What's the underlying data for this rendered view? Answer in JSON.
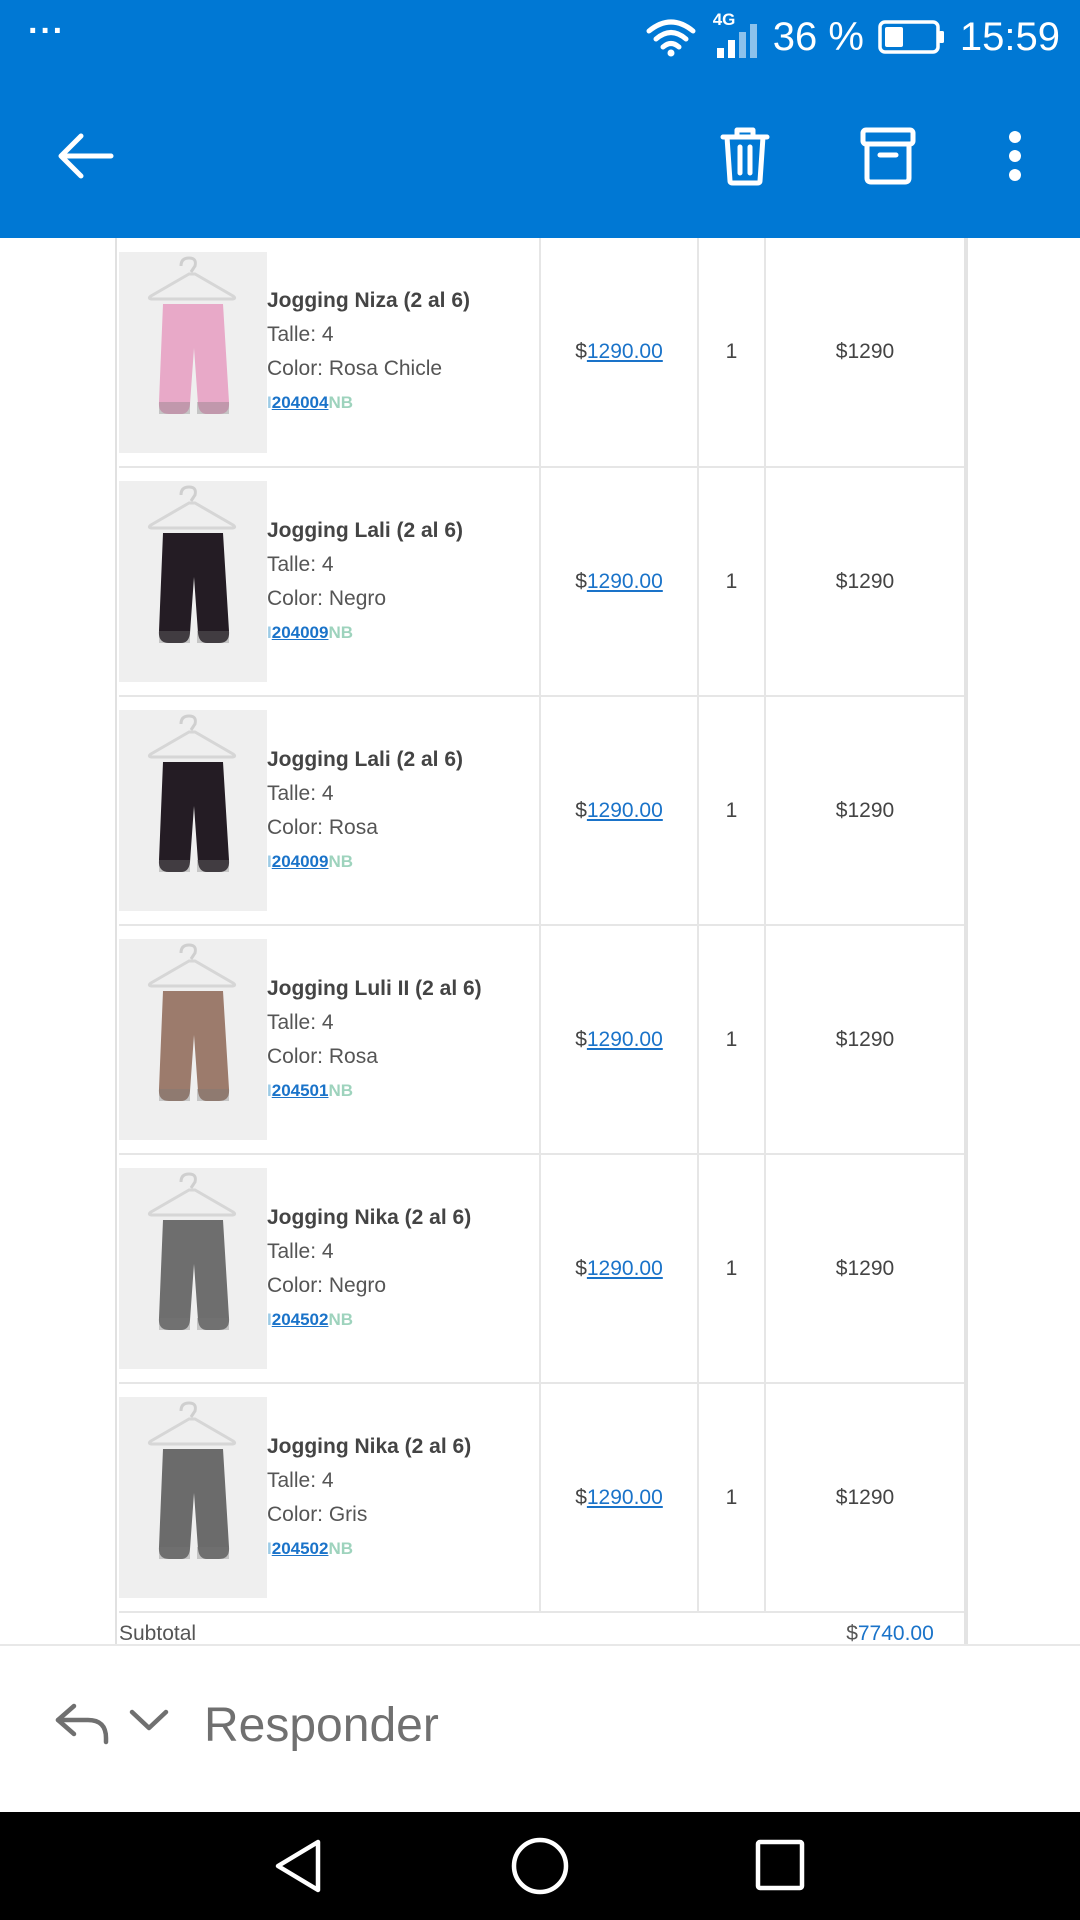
{
  "status_bar": {
    "menu_dots": "···",
    "network": "4G",
    "battery_percent": "36 %",
    "time": "15:59",
    "battery_level": 0.36
  },
  "app_bar": {
    "icons": [
      "back-arrow-icon",
      "trash-icon",
      "archive-icon",
      "more-vert-icon"
    ]
  },
  "items": [
    {
      "name": "Jogging Niza (2 al 6)",
      "size": "Talle: 4",
      "color": "Color: Rosa Chicle",
      "sku_prefix": "I",
      "sku_code": "204004",
      "sku_suffix": "NB",
      "currency": "$",
      "price": "1290.00",
      "qty": "1",
      "total": "$1290",
      "pants_color": "#e8a9c8"
    },
    {
      "name": "Jogging Lali (2 al 6)",
      "size": "Talle: 4",
      "color": "Color: Negro",
      "sku_prefix": "I",
      "sku_code": "204009",
      "sku_suffix": "NB",
      "currency": "$",
      "price": "1290.00",
      "qty": "1",
      "total": "$1290",
      "pants_color": "#241c24"
    },
    {
      "name": "Jogging Lali (2 al 6)",
      "size": "Talle: 4",
      "color": "Color: Rosa",
      "sku_prefix": "I",
      "sku_code": "204009",
      "sku_suffix": "NB",
      "currency": "$",
      "price": "1290.00",
      "qty": "1",
      "total": "$1290",
      "pants_color": "#241c24"
    },
    {
      "name": "Jogging Luli II (2 al 6)",
      "size": "Talle: 4",
      "color": "Color: Rosa",
      "sku_prefix": "I",
      "sku_code": "204501",
      "sku_suffix": "NB",
      "currency": "$",
      "price": "1290.00",
      "qty": "1",
      "total": "$1290",
      "pants_color": "#9c7b6c"
    },
    {
      "name": "Jogging Nika (2 al 6)",
      "size": "Talle: 4",
      "color": "Color: Negro",
      "sku_prefix": "I",
      "sku_code": "204502",
      "sku_suffix": "NB",
      "currency": "$",
      "price": "1290.00",
      "qty": "1",
      "total": "$1290",
      "pants_color": "#6e6e6e"
    },
    {
      "name": "Jogging Nika (2 al 6)",
      "size": "Talle: 4",
      "color": "Color: Gris",
      "sku_prefix": "I",
      "sku_code": "204502",
      "sku_suffix": "NB",
      "currency": "$",
      "price": "1290.00",
      "qty": "1",
      "total": "$1290",
      "pants_color": "#6b6b6b"
    }
  ],
  "subtotal": {
    "label": "Subtotal",
    "currency": "$",
    "value": "7740.00"
  },
  "reply_bar": {
    "label": "Responder"
  },
  "nav_bar": {
    "icons": [
      "nav-back-icon",
      "nav-home-icon",
      "nav-recents-icon"
    ]
  }
}
